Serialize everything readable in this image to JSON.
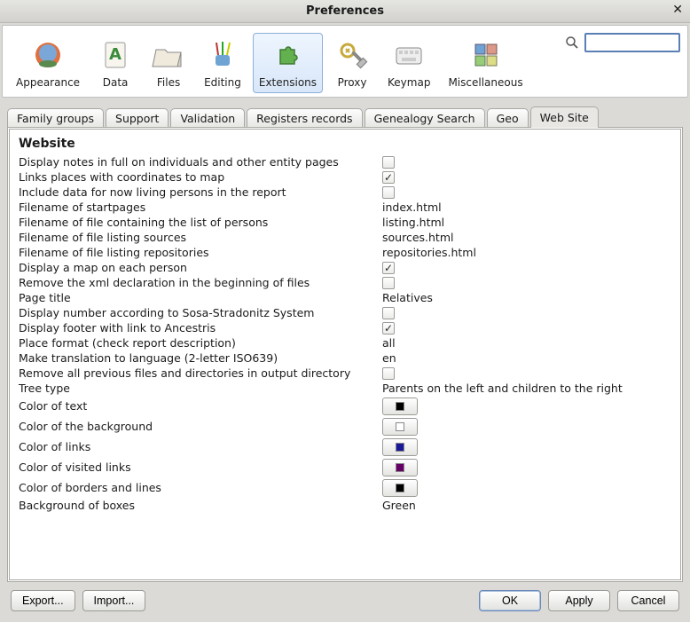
{
  "window": {
    "title": "Preferences"
  },
  "toolbar": {
    "categories": [
      {
        "id": "appearance",
        "label": "Appearance"
      },
      {
        "id": "data",
        "label": "Data"
      },
      {
        "id": "files",
        "label": "Files"
      },
      {
        "id": "editing",
        "label": "Editing"
      },
      {
        "id": "extensions",
        "label": "Extensions",
        "selected": true
      },
      {
        "id": "proxy",
        "label": "Proxy"
      },
      {
        "id": "keymap",
        "label": "Keymap"
      },
      {
        "id": "miscellaneous",
        "label": "Miscellaneous"
      }
    ],
    "search_placeholder": ""
  },
  "tabs": {
    "items": [
      {
        "id": "family-groups",
        "label": "Family groups"
      },
      {
        "id": "support",
        "label": "Support"
      },
      {
        "id": "validation",
        "label": "Validation"
      },
      {
        "id": "registers-records",
        "label": "Registers records"
      },
      {
        "id": "genealogy-search",
        "label": "Genealogy Search"
      },
      {
        "id": "geo",
        "label": "Geo"
      },
      {
        "id": "web-site",
        "label": "Web Site",
        "active": true
      }
    ]
  },
  "section": {
    "title": "Website",
    "rows": [
      {
        "label": "Display notes in full on individuals and other entity pages",
        "type": "check",
        "checked": false
      },
      {
        "label": "Links places with coordinates to map",
        "type": "check",
        "checked": true
      },
      {
        "label": "Include data for now living persons in the report",
        "type": "check",
        "checked": false
      },
      {
        "label": "Filename of startpages",
        "type": "text",
        "value": "index.html"
      },
      {
        "label": "Filename of file containing the list of persons",
        "type": "text",
        "value": "listing.html"
      },
      {
        "label": "Filename of file listing sources",
        "type": "text",
        "value": "sources.html"
      },
      {
        "label": "Filename of file listing repositories",
        "type": "text",
        "value": "repositories.html"
      },
      {
        "label": "Display a map on each person",
        "type": "check",
        "checked": true
      },
      {
        "label": "Remove the xml declaration in the beginning of files",
        "type": "check",
        "checked": false
      },
      {
        "label": "Page title",
        "type": "text",
        "value": "Relatives"
      },
      {
        "label": "Display number according to Sosa-Stradonitz System",
        "type": "check",
        "checked": false
      },
      {
        "label": "Display footer with link to Ancestris",
        "type": "check",
        "checked": true
      },
      {
        "label": "Place format (check report description)",
        "type": "text",
        "value": "all"
      },
      {
        "label": "Make translation to language (2-letter ISO639)",
        "type": "text",
        "value": "en"
      },
      {
        "label": "Remove all previous files and directories in output directory",
        "type": "check",
        "checked": false
      },
      {
        "label": "Tree type",
        "type": "text",
        "value": "Parents on the left and children to the right"
      },
      {
        "label": "Color of text",
        "type": "color",
        "value": "#000000"
      },
      {
        "label": "Color of the background",
        "type": "color",
        "value": "#ffffff"
      },
      {
        "label": "Color of links",
        "type": "color",
        "value": "#1a1a99"
      },
      {
        "label": "Color of visited links",
        "type": "color",
        "value": "#660066"
      },
      {
        "label": "Color of borders and lines",
        "type": "color",
        "value": "#000000"
      },
      {
        "label": "Background of boxes",
        "type": "text",
        "value": "Green"
      }
    ]
  },
  "buttons": {
    "export": "Export...",
    "import": "Import...",
    "ok": "OK",
    "apply": "Apply",
    "cancel": "Cancel"
  }
}
